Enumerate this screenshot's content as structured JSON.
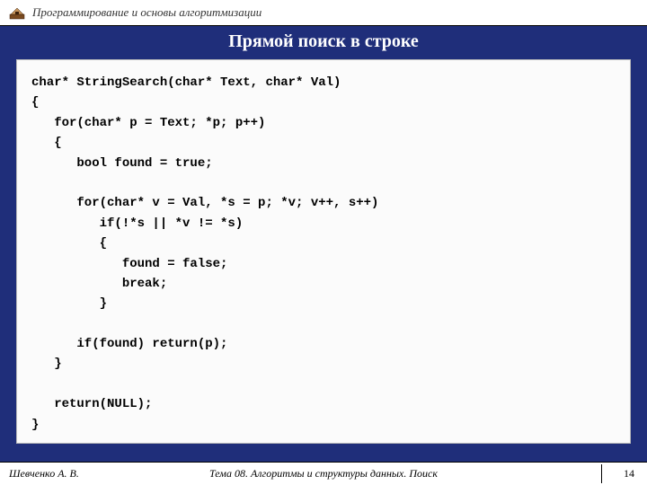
{
  "header": {
    "course_title": "Программирование и основы алгоритмизации"
  },
  "slide": {
    "title": "Прямой поиск в строке",
    "code": "char* StringSearch(char* Text, char* Val)\n{\n   for(char* p = Text; *p; p++)\n   {\n      bool found = true;\n\n      for(char* v = Val, *s = p; *v; v++, s++)\n         if(!*s || *v != *s)\n         {\n            found = false;\n            break;\n         }\n\n      if(found) return(p);\n   }\n\n   return(NULL);\n}"
  },
  "footer": {
    "author": "Шевченко А. В.",
    "topic": "Тема 08. Алгоритмы и структуры данных. Поиск",
    "page": "14"
  }
}
